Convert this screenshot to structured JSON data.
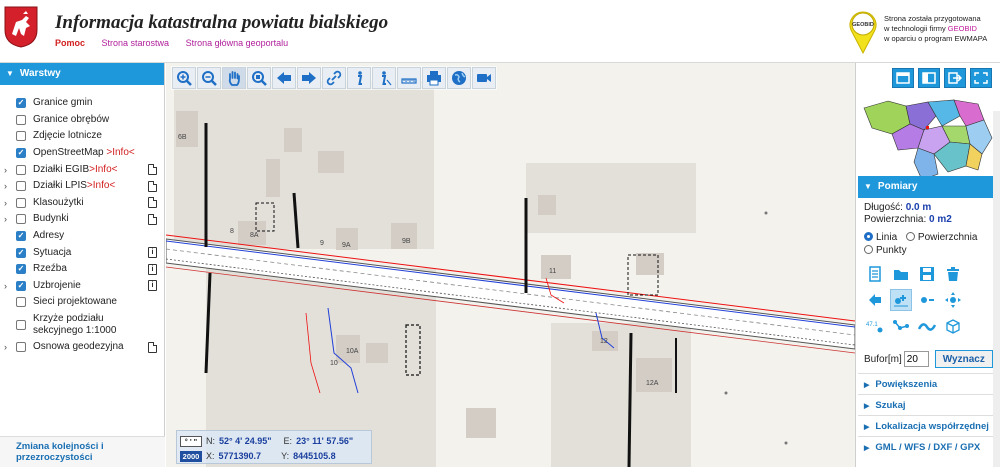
{
  "header": {
    "title": "Informacja katastralna powiatu bialskiego",
    "links": [
      "Pomoc",
      "Strona starostwa",
      "Strona główna geoportalu"
    ],
    "active_link": "Pomoc",
    "geobid_line1": "Strona została przygotowana",
    "geobid_line2_prefix": "w technologii firmy ",
    "geobid_brand": "GEOBID",
    "geobid_line3": "w oparciu o program EWMAPA",
    "geobid_logo_text": "GEOBID"
  },
  "layers": {
    "header_label": "Warstwy",
    "items": [
      {
        "label": "Granice gmin",
        "info": "",
        "checked": true,
        "expandable": false,
        "icon": "none"
      },
      {
        "label": "Granice obrębów",
        "info": "",
        "checked": false,
        "expandable": false,
        "icon": "none"
      },
      {
        "label": "Zdjęcie lotnicze",
        "info": "",
        "checked": false,
        "expandable": false,
        "icon": "none"
      },
      {
        "label": "OpenStreetMap ",
        "info": ">Info<",
        "checked": true,
        "expandable": false,
        "icon": "none"
      },
      {
        "label": "Działki EGIB",
        "info": ">Info<",
        "checked": false,
        "expandable": true,
        "icon": "document-icon"
      },
      {
        "label": "Działki LPIS",
        "info": ">Info<",
        "checked": false,
        "expandable": true,
        "icon": "document-icon"
      },
      {
        "label": "Klasoużytki",
        "info": "",
        "checked": false,
        "expandable": true,
        "icon": "document-icon"
      },
      {
        "label": "Budynki",
        "info": "",
        "checked": false,
        "expandable": true,
        "icon": "document-icon"
      },
      {
        "label": "Adresy",
        "info": "",
        "checked": true,
        "expandable": false,
        "icon": "none"
      },
      {
        "label": "Sytuacja",
        "info": "",
        "checked": true,
        "expandable": false,
        "icon": "info-icon"
      },
      {
        "label": "Rzeźba",
        "info": "",
        "checked": true,
        "expandable": false,
        "icon": "info-icon"
      },
      {
        "label": "Uzbrojenie",
        "info": "",
        "checked": true,
        "expandable": true,
        "icon": "info-icon"
      },
      {
        "label": "Sieci projektowane",
        "info": "",
        "checked": false,
        "expandable": false,
        "icon": "none"
      },
      {
        "label": "Krzyże podziału sekcyjnego 1:1000",
        "info": "",
        "checked": false,
        "expandable": false,
        "icon": "none"
      },
      {
        "label": "Osnowa geodezyjna",
        "info": "",
        "checked": false,
        "expandable": true,
        "icon": "document-icon"
      }
    ],
    "footer_label": "Zmiana kolejności i przezroczystości"
  },
  "toolbar": {
    "tools": [
      "zoom-in-icon",
      "zoom-out-icon",
      "pan-hand-icon",
      "zoom-window-icon",
      "arrow-back-icon",
      "arrow-forward-icon",
      "link-icon",
      "info-icon",
      "info-cursor-icon",
      "ruler-icon",
      "print-icon",
      "globe-icon",
      "video-icon"
    ],
    "active_tool": "pan-hand-icon"
  },
  "map_labels": [
    "6B",
    "8",
    "8A",
    "9",
    "9A",
    "9B",
    "11",
    "10A",
    "10",
    "12",
    "12A"
  ],
  "coords": {
    "geo_box": "° ' \"",
    "n_label": "N:",
    "n_value": "52° 4' 24.95\"",
    "e_label": "E:",
    "e_value": "23° 11' 57.56\"",
    "xy_box": "2000",
    "x_label": "X:",
    "x_value": "5771390.7",
    "y_label": "Y:",
    "y_value": "8445105.8"
  },
  "layout_buttons": [
    "window-icon",
    "split-panel-icon",
    "export-icon",
    "fullscreen-icon"
  ],
  "measure": {
    "header_label": "Pomiary",
    "length_label": "Długość:",
    "length_value": "0.0 m",
    "area_label": "Powierzchnia:",
    "area_value": "0 m2",
    "mode_options": [
      "Linia",
      "Powierzchnia",
      "Punkty"
    ],
    "mode_selected": "Linia",
    "tools": [
      "document-list-icon",
      "folder-icon",
      "save-icon",
      "trash-icon",
      "arrow-left-icon",
      "add-point-icon",
      "remove-point-icon",
      "move-point-icon",
      "measure-label-icon",
      "polyline-icon",
      "curve-icon",
      "cube-icon"
    ],
    "selected_tool": "add-point-icon",
    "measure_label_text": "47.1",
    "buffer_label": "Bufor[m]",
    "buffer_value": "20",
    "compute_label": "Wyznacz"
  },
  "accordion": [
    "Powiększenia",
    "Szukaj",
    "Lokalizacja współrzędnej",
    "GML / WFS / DXF / GPX"
  ],
  "colors": {
    "accent": "#1f98db",
    "link": "#b0209b",
    "active_link": "#d21f1f",
    "value_blue": "#1a3f9e",
    "info_red": "#d21f1f"
  }
}
